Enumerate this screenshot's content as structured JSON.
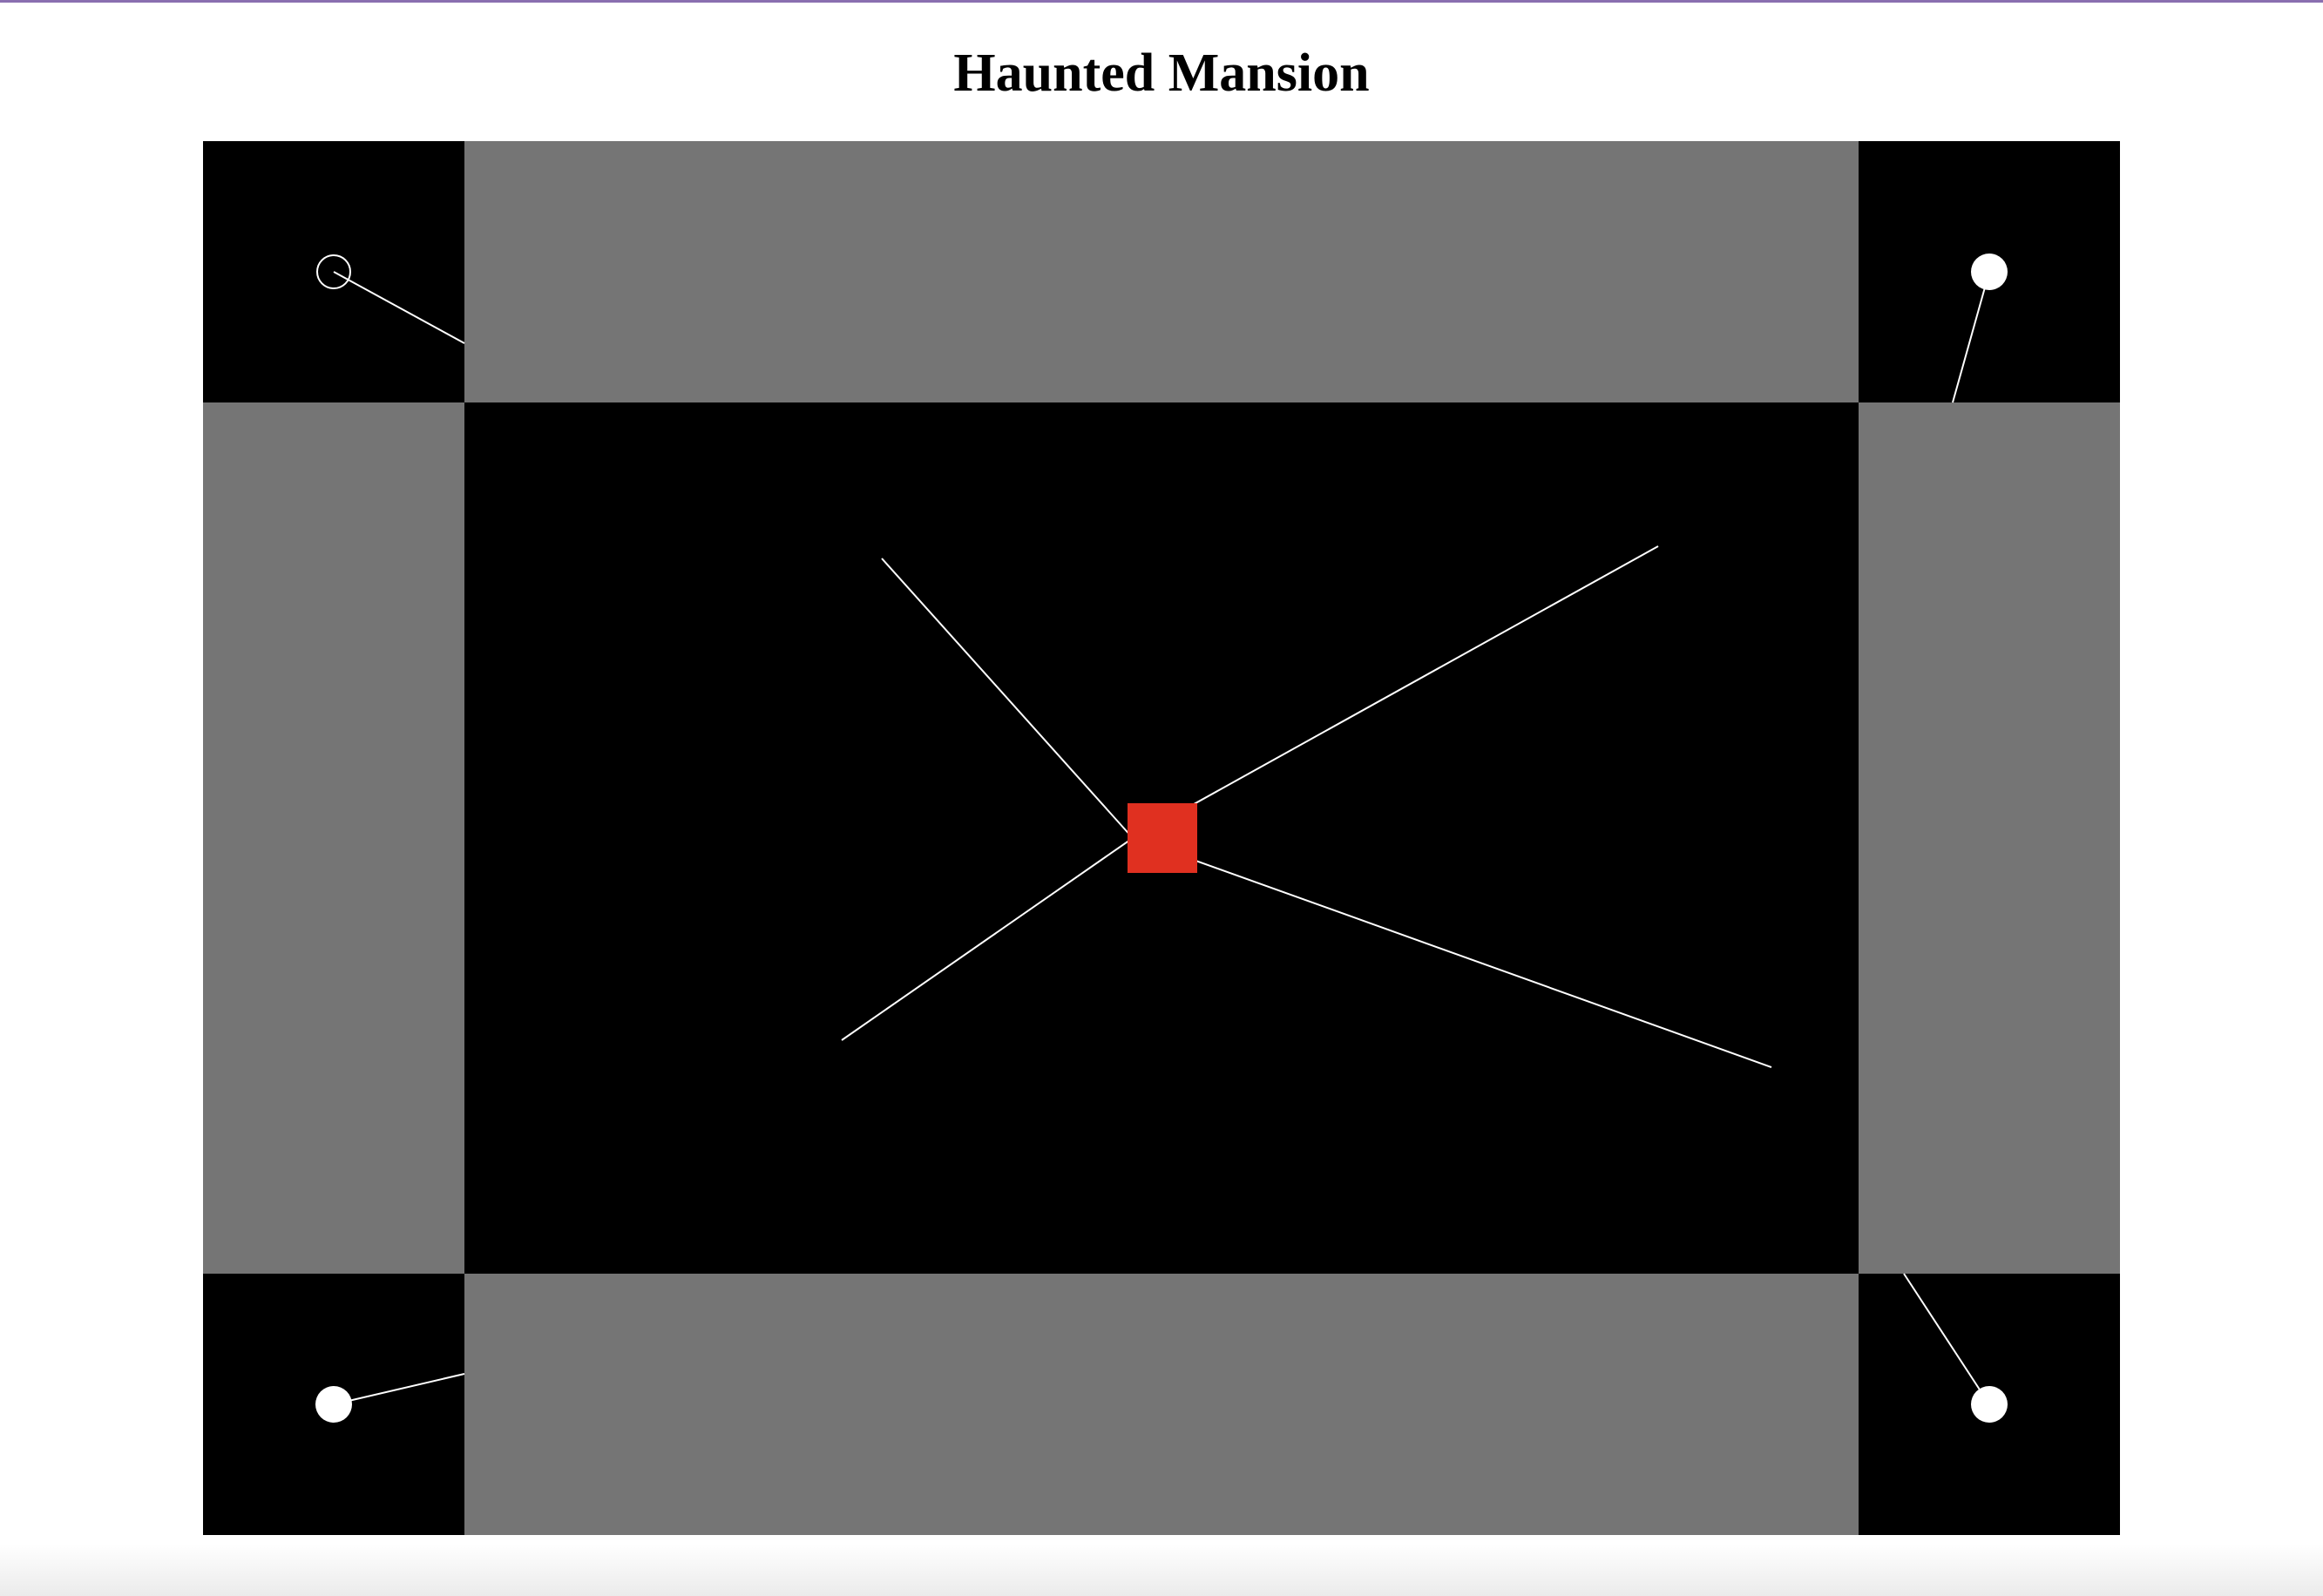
{
  "page": {
    "title": "Haunted Mansion"
  },
  "colors": {
    "room_dark": "#000000",
    "room_gray": "#757575",
    "player": "#e03020",
    "ghost": "#ffffff",
    "wire": "#ffffff"
  },
  "board": {
    "rooms": [
      {
        "name": "top-left-room",
        "shade": "dark"
      },
      {
        "name": "top-hall",
        "shade": "gray"
      },
      {
        "name": "top-right-room",
        "shade": "dark"
      },
      {
        "name": "left-hall",
        "shade": "gray"
      },
      {
        "name": "center-room",
        "shade": "dark"
      },
      {
        "name": "right-hall",
        "shade": "gray"
      },
      {
        "name": "bottom-left-room",
        "shade": "dark"
      },
      {
        "name": "bottom-hall",
        "shade": "gray"
      },
      {
        "name": "bottom-right-room",
        "shade": "dark"
      }
    ],
    "player": {
      "name": "player-square"
    },
    "ghosts": [
      {
        "name": "ghost-top-left",
        "style": "hollow"
      },
      {
        "name": "ghost-top-right",
        "style": "filled"
      },
      {
        "name": "ghost-bottom-left",
        "style": "filled"
      },
      {
        "name": "ghost-bottom-right",
        "style": "filled"
      }
    ]
  }
}
